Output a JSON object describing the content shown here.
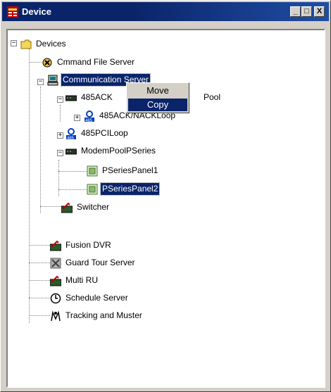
{
  "window": {
    "title": "Device",
    "minimize_label": "_",
    "maximize_label": "□",
    "close_label": "X"
  },
  "tree": {
    "root": "Devices",
    "command_file_server": "Cmmand File Server",
    "communication_server": "Communication Server",
    "ack_pool": "485ACK",
    "ack_pool_suffix": "Pool",
    "ack_nack_loop": "485ACK/NACKLoop",
    "pci_loop": "485PCILoop",
    "modem_pool": "ModemPoolPSeries",
    "panel1": "PSeriesPanel1",
    "panel2": "PSeriesPanel2",
    "switcher": "Switcher",
    "fusion_dvr": "Fusion DVR",
    "guard_tour": "Guard Tour Server",
    "multi_ru": "Multi RU",
    "schedule": "Schedule Server",
    "tracking": "Tracking and Muster"
  },
  "context_menu": {
    "move": "Move",
    "copy": "Copy"
  },
  "icon_badge_485": "485",
  "expander": {
    "expanded": "−",
    "collapsed": "+"
  },
  "colors": {
    "selection": "#0a246a",
    "titlebar": "#0a246a",
    "face": "#d4d0c8"
  }
}
